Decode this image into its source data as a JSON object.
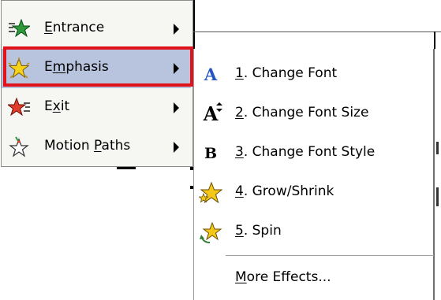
{
  "main_menu": {
    "items": [
      {
        "label_pre": "",
        "label_key": "E",
        "label_post": "ntrance",
        "icon": "entrance-star-icon",
        "has_submenu": true
      },
      {
        "label_pre": "E",
        "label_key": "m",
        "label_post": "phasis",
        "icon": "emphasis-star-icon",
        "has_submenu": true,
        "highlighted": true
      },
      {
        "label_pre": "E",
        "label_key": "x",
        "label_post": "it",
        "icon": "exit-star-icon",
        "has_submenu": true
      },
      {
        "label_pre": "Motion ",
        "label_key": "P",
        "label_post": "aths",
        "icon": "motion-paths-star-icon",
        "has_submenu": true
      }
    ]
  },
  "emphasis_menu": {
    "items": [
      {
        "num": "1",
        "label": ". Change Font",
        "icon": "change-font-icon",
        "glyph": "A"
      },
      {
        "num": "2",
        "label": ". Change Font Size",
        "icon": "change-font-size-icon",
        "glyph": "A"
      },
      {
        "num": "3",
        "label": ". Change Font Style",
        "icon": "change-font-style-icon",
        "glyph": "B"
      },
      {
        "num": "4",
        "label": ". Grow/Shrink",
        "icon": "grow-shrink-icon"
      },
      {
        "num": "5",
        "label": ". Spin",
        "icon": "spin-icon"
      }
    ],
    "more": {
      "key": "M",
      "rest": "ore Effects..."
    }
  },
  "colors": {
    "highlight": "#b8c4de",
    "highlight_border": "#e0121b",
    "menu_bg": "#f6f6f3",
    "font_icon_blue": "#2455c3"
  }
}
